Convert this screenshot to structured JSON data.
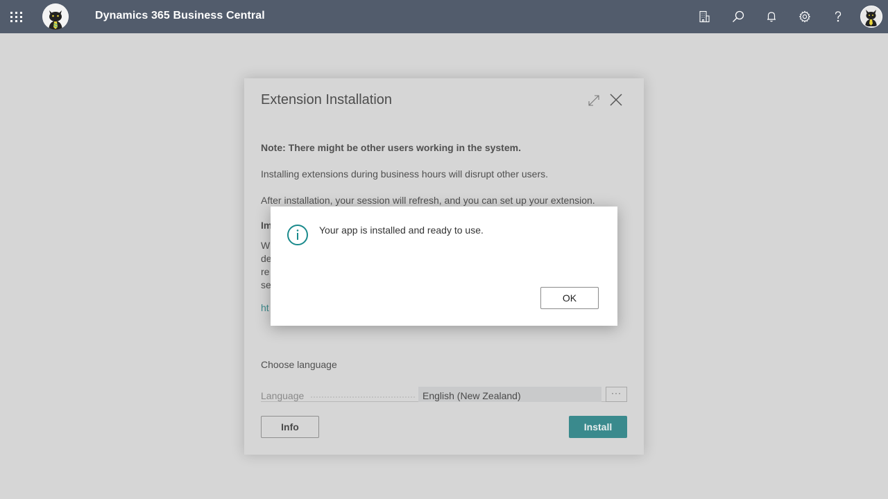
{
  "topbar": {
    "app_title": "Dynamics 365 Business Central",
    "icons": [
      "waffle-icon",
      "company-logo",
      "company-icon",
      "search-icon",
      "bell-icon",
      "gear-icon",
      "help-icon",
      "user-avatar"
    ],
    "background_color": "#525c6c"
  },
  "dialog": {
    "title": "Extension Installation",
    "note": "Note: There might be other users working in the system.",
    "paragraph1": "Installing extensions during business hours will disrupt other users.",
    "paragraph2": "After installation, your session will refresh, and you can set up your extension.",
    "obscured_heading": "Im",
    "obscured_lines": [
      "W",
      "de",
      "re",
      "se"
    ],
    "obscured_link": "ht",
    "section_label": "Choose language",
    "language_field": {
      "label": "Language",
      "value": "English (New Zealand)",
      "more_button": "···"
    },
    "info_button": "Info",
    "install_button": "Install",
    "accent_color": "#3a8a8d"
  },
  "message_box": {
    "icon": "info-icon",
    "message": "Your app is installed and ready to use.",
    "ok_button": "OK",
    "icon_color": "#1a8a8c"
  }
}
